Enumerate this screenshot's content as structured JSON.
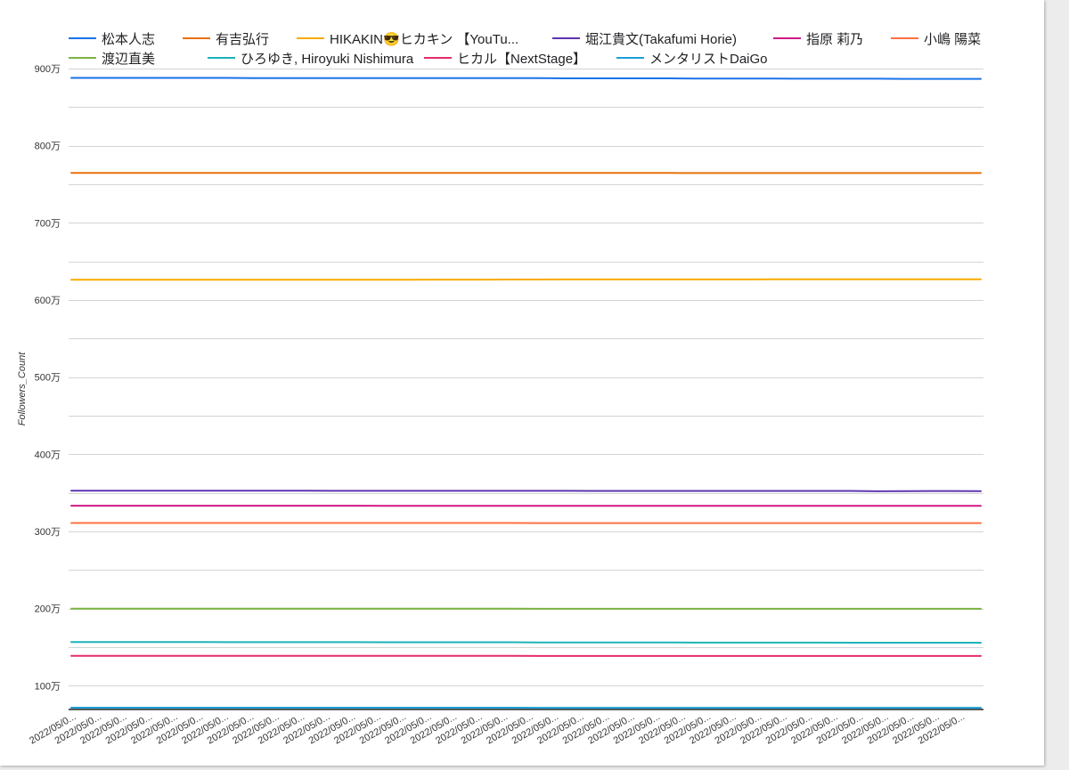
{
  "chart_data": {
    "type": "line",
    "ylabel": "Followers_Count",
    "ylim": [
      693000,
      9000000
    ],
    "yticks": [
      1000000,
      2000000,
      3000000,
      4000000,
      5000000,
      6000000,
      7000000,
      8000000,
      9000000
    ],
    "ytick_labels": [
      "100万",
      "200万",
      "300万",
      "400万",
      "500万",
      "600万",
      "700万",
      "800万",
      "900万"
    ],
    "grid": true,
    "legend": "top",
    "categories": [
      "2022/05/0...",
      "2022/05/0...",
      "2022/05/0...",
      "2022/05/0...",
      "2022/05/0...",
      "2022/05/0...",
      "2022/05/0...",
      "2022/05/0...",
      "2022/05/0...",
      "2022/05/0...",
      "2022/05/0...",
      "2022/05/0...",
      "2022/05/0...",
      "2022/05/0...",
      "2022/05/0...",
      "2022/05/0...",
      "2022/05/0...",
      "2022/05/0...",
      "2022/05/0...",
      "2022/05/0...",
      "2022/05/0...",
      "2022/05/0...",
      "2022/05/0...",
      "2022/05/0...",
      "2022/05/0...",
      "2022/05/0...",
      "2022/05/0...",
      "2022/05/0...",
      "2022/05/0...",
      "2022/05/0...",
      "2022/05/0...",
      "2022/05/0...",
      "2022/05/0...",
      "2022/05/0...",
      "2022/05/0...",
      "2022/05/0..."
    ],
    "series": [
      {
        "name": "松本人志",
        "color": "#1a73e8",
        "values": [
          8879000,
          8879000,
          8879000,
          8879000,
          8879000,
          8879000,
          8879000,
          8877000,
          8877000,
          8877000,
          8877000,
          8877000,
          8877000,
          8875000,
          8875000,
          8875000,
          8875000,
          8875000,
          8875000,
          8873000,
          8873000,
          8873000,
          8873000,
          8873000,
          8871000,
          8871000,
          8871000,
          8871000,
          8869000,
          8869000,
          8869000,
          8869000,
          8866000,
          8866000,
          8866000,
          8866000
        ]
      },
      {
        "name": "有吉弘行",
        "color": "#e8710a",
        "values": [
          7648000,
          7648000,
          7648000,
          7648000,
          7648000,
          7648000,
          7648000,
          7648000,
          7648000,
          7648000,
          7648000,
          7648000,
          7647000,
          7647000,
          7647000,
          7647000,
          7647000,
          7647000,
          7647000,
          7647000,
          7647000,
          7647000,
          7647000,
          7647000,
          7646000,
          7646000,
          7646000,
          7646000,
          7646000,
          7646000,
          7646000,
          7646000,
          7646000,
          7646000,
          7646000,
          7646000
        ]
      },
      {
        "name": "HIKAKIN😎ヒカキン 【YouTu...",
        "color": "#f9ab00",
        "values": [
          6262000,
          6262000,
          6262000,
          6262000,
          6262000,
          6262000,
          6262000,
          6262000,
          6262000,
          6262000,
          6262000,
          6262000,
          6262000,
          6263000,
          6264000,
          6264000,
          6265000,
          6266000,
          6266000,
          6267000,
          6267000,
          6267000,
          6267000,
          6267000,
          6267000,
          6267000,
          6267000,
          6268000,
          6268000,
          6268000,
          6268000,
          6268000,
          6268000,
          6268000,
          6268000,
          6268000
        ]
      },
      {
        "name": "堀江貴文(Takafumi Horie)",
        "color": "#5e35b1",
        "values": [
          3528000,
          3528000,
          3528000,
          3528000,
          3528000,
          3528000,
          3528000,
          3528000,
          3528000,
          3528000,
          3527000,
          3527000,
          3527000,
          3527000,
          3527000,
          3527000,
          3527000,
          3527000,
          3527000,
          3527000,
          3526000,
          3526000,
          3526000,
          3526000,
          3526000,
          3526000,
          3526000,
          3526000,
          3526000,
          3526000,
          3525000,
          3521000,
          3523000,
          3524000,
          3524000,
          3523000
        ]
      },
      {
        "name": "指原 莉乃",
        "color": "#d01884",
        "values": [
          3334000,
          3334000,
          3334000,
          3334000,
          3334000,
          3334000,
          3334000,
          3334000,
          3334000,
          3334000,
          3334000,
          3334000,
          3333000,
          3333000,
          3333000,
          3333000,
          3333000,
          3333000,
          3333000,
          3333000,
          3333000,
          3333000,
          3333000,
          3333000,
          3332000,
          3332000,
          3332000,
          3332000,
          3332000,
          3332000,
          3332000,
          3332000,
          3332000,
          3332000,
          3332000,
          3332000
        ]
      },
      {
        "name": "小嶋 陽菜",
        "color": "#ff7043",
        "values": [
          3110000,
          3110000,
          3110000,
          3110000,
          3110000,
          3110000,
          3110000,
          3110000,
          3110000,
          3110000,
          3110000,
          3110000,
          3110000,
          3110000,
          3110000,
          3110000,
          3110000,
          3110000,
          3109000,
          3109000,
          3109000,
          3109000,
          3109000,
          3109000,
          3109000,
          3109000,
          3109000,
          3109000,
          3109000,
          3109000,
          3109000,
          3109000,
          3109000,
          3109000,
          3109000,
          3109000
        ]
      },
      {
        "name": "渡辺直美",
        "color": "#7cb342",
        "values": [
          1999000,
          1999000,
          1999000,
          1999000,
          1999000,
          1999000,
          1999000,
          1999000,
          1999000,
          1999000,
          1999000,
          1999000,
          1999000,
          1999000,
          1999000,
          1999000,
          1999000,
          1999000,
          1998000,
          1998000,
          1998000,
          1998000,
          1998000,
          1998000,
          1998000,
          1998000,
          1998000,
          1998000,
          1998000,
          1998000,
          1998000,
          1998000,
          1998000,
          1998000,
          1998000,
          1998000
        ]
      },
      {
        "name": "ひろゆき, Hiroyuki Nishimura",
        "color": "#1bb3b8",
        "values": [
          1566000,
          1566000,
          1566000,
          1566000,
          1566000,
          1566000,
          1565000,
          1565000,
          1565000,
          1565000,
          1565000,
          1565000,
          1564000,
          1564000,
          1564000,
          1564000,
          1564000,
          1564000,
          1562000,
          1562000,
          1562000,
          1562000,
          1562000,
          1562000,
          1560000,
          1560000,
          1560000,
          1560000,
          1560000,
          1560000,
          1558000,
          1558000,
          1558000,
          1558000,
          1558000,
          1558000
        ]
      },
      {
        "name": "ヒカル【NextStage】",
        "color": "#e52b6a",
        "values": [
          1387000,
          1387000,
          1387000,
          1387000,
          1387000,
          1387000,
          1387000,
          1387000,
          1387000,
          1387000,
          1387000,
          1387000,
          1387000,
          1387000,
          1387000,
          1387000,
          1387000,
          1387000,
          1386000,
          1386000,
          1386000,
          1386000,
          1386000,
          1386000,
          1386000,
          1386000,
          1386000,
          1386000,
          1386000,
          1386000,
          1386000,
          1386000,
          1386000,
          1386000,
          1386000,
          1386000
        ]
      },
      {
        "name": "メンタリストDaiGo",
        "color": "#1a9fd6",
        "values": [
          716000,
          716000,
          716000,
          716000,
          716000,
          716000,
          716000,
          716000,
          716000,
          716000,
          716000,
          716000,
          716000,
          716000,
          716000,
          716000,
          716000,
          716000,
          715000,
          715000,
          715000,
          715000,
          715000,
          715000,
          715000,
          715000,
          715000,
          715000,
          715000,
          715000,
          715000,
          715000,
          715000,
          715000,
          715000,
          715000
        ]
      }
    ]
  }
}
